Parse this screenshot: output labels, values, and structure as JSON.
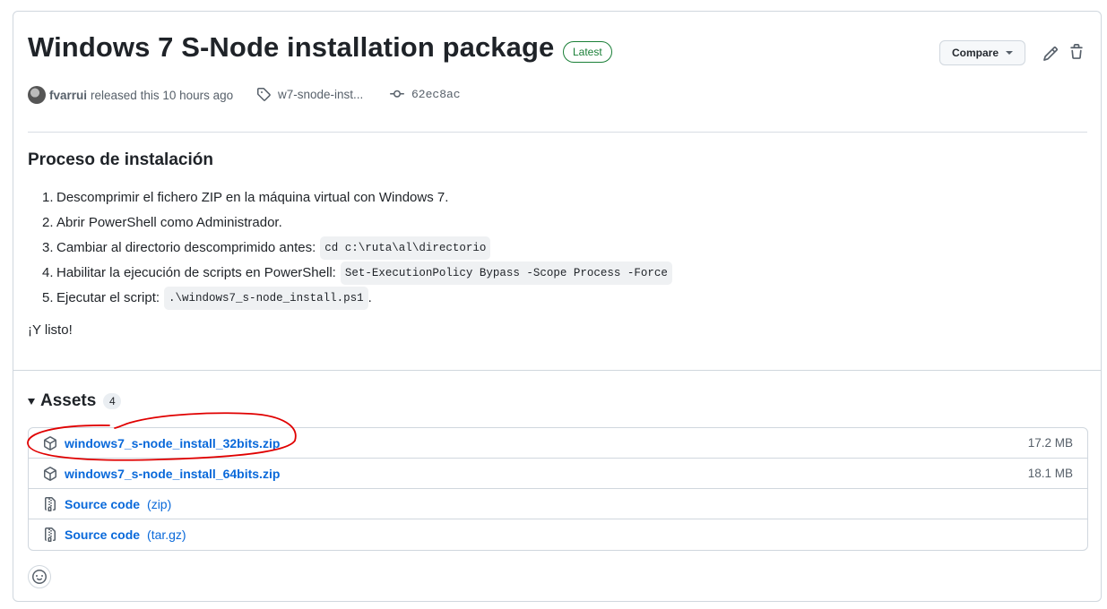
{
  "release": {
    "title": "Windows 7 S-Node installation package",
    "badge": "Latest",
    "compare_label": "Compare",
    "author": "fvarrui",
    "released_text": "released this 10 hours ago",
    "tag": "w7-snode-inst...",
    "commit": "62ec8ac"
  },
  "notes": {
    "heading": "Proceso de instalación",
    "steps": [
      {
        "num": "1.",
        "text": "Descomprimir el fichero ZIP en la máquina virtual con Windows 7.",
        "code": "",
        "after": ""
      },
      {
        "num": "2.",
        "text": "Abrir PowerShell como Administrador.",
        "code": "",
        "after": ""
      },
      {
        "num": "3.",
        "text": "Cambiar al directorio descomprimido antes:",
        "code": "cd c:\\ruta\\al\\directorio",
        "after": ""
      },
      {
        "num": "4.",
        "text": "Habilitar la ejecución de scripts en PowerShell:",
        "code": "Set-ExecutionPolicy Bypass -Scope Process -Force",
        "after": ""
      },
      {
        "num": "5.",
        "text": "Ejecutar el script:",
        "code": ".\\windows7_s-node_install.ps1",
        "after": "."
      }
    ],
    "closing": "¡Y listo!"
  },
  "assets": {
    "heading": "Assets",
    "count": "4",
    "items": [
      {
        "name": "windows7_s-node_install_32bits.zip",
        "format": "",
        "size": "17.2 MB",
        "icon": "package-icon"
      },
      {
        "name": "windows7_s-node_install_64bits.zip",
        "format": "",
        "size": "18.1 MB",
        "icon": "package-icon"
      },
      {
        "name": "Source code",
        "format": "(zip)",
        "size": "",
        "icon": "file-zip-icon"
      },
      {
        "name": "Source code",
        "format": "(tar.gz)",
        "size": "",
        "icon": "file-zip-icon"
      }
    ]
  },
  "colors": {
    "link": "#0969da",
    "latest_badge": "#1a7f37",
    "annotation": "#e00000"
  }
}
